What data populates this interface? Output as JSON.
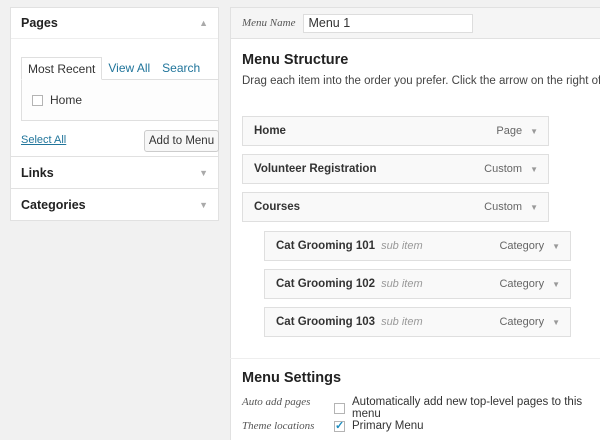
{
  "left_panel": {
    "pages": {
      "title": "Pages",
      "tabs": [
        "Most Recent",
        "View All",
        "Search"
      ],
      "items": [
        {
          "label": "Home",
          "checked": false
        }
      ],
      "select_all": "Select All",
      "add_button": "Add to Menu"
    },
    "links": {
      "title": "Links"
    },
    "categories": {
      "title": "Categories"
    }
  },
  "menu_name": {
    "label": "Menu Name",
    "value": "Menu 1"
  },
  "structure": {
    "title": "Menu Structure",
    "instructions": "Drag each item into the order you prefer. Click the arrow on the right of the item to reveal additional configuration options.",
    "items": [
      {
        "title": "Home",
        "sub": "",
        "type": "Page",
        "depth": 0
      },
      {
        "title": "Volunteer Registration",
        "sub": "",
        "type": "Custom",
        "depth": 0
      },
      {
        "title": "Courses",
        "sub": "",
        "type": "Custom",
        "depth": 0
      },
      {
        "title": "Cat Grooming 101",
        "sub": "sub item",
        "type": "Category",
        "depth": 1
      },
      {
        "title": "Cat Grooming 102",
        "sub": "sub item",
        "type": "Category",
        "depth": 1
      },
      {
        "title": "Cat Grooming 103",
        "sub": "sub item",
        "type": "Category",
        "depth": 1
      }
    ]
  },
  "settings": {
    "title": "Menu Settings",
    "auto_add": {
      "label": "Auto add pages",
      "option": "Automatically add new top-level pages to this menu",
      "checked": false
    },
    "theme_locations": {
      "label": "Theme locations",
      "option": "Primary Menu",
      "checked": true
    }
  },
  "colors": {
    "link": "#21759b",
    "panel_bg": "#ffffff",
    "page_bg": "#f1f1f1"
  }
}
